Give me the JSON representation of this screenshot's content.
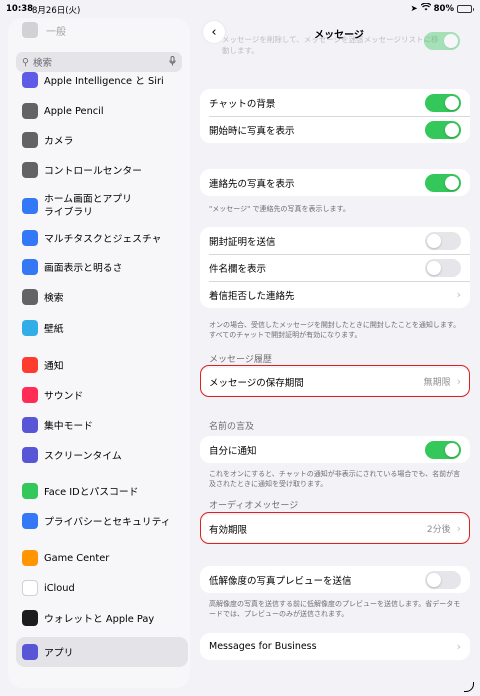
{
  "status": {
    "time": "10:38",
    "date": "8月26日(火)",
    "battery": "80%",
    "battery_level": 0.8
  },
  "sidebar": {
    "faded_top": "一般",
    "search_placeholder": "検索",
    "items": [
      {
        "label": "Apple Intelligence と Siri",
        "icon": "siri-icon",
        "color": "#5e5ce6"
      },
      {
        "label": "Apple Pencil",
        "icon": "pencil-icon",
        "color": "#636366"
      },
      {
        "label": "カメラ",
        "icon": "camera-icon",
        "color": "#636366"
      },
      {
        "label": "コントロールセンター",
        "icon": "control-center-icon",
        "color": "#636366"
      },
      {
        "label": "ホーム画面とアプリ\nライブラリ",
        "icon": "home-screen-icon",
        "color": "#3478f6"
      },
      {
        "label": "マルチタスクとジェスチャ",
        "icon": "multitask-icon",
        "color": "#3478f6"
      },
      {
        "label": "画面表示と明るさ",
        "icon": "brightness-icon",
        "color": "#3478f6"
      },
      {
        "label": "検索",
        "icon": "search-icon",
        "color": "#636366"
      },
      {
        "label": "壁紙",
        "icon": "wallpaper-icon",
        "color": "#32ade6"
      },
      {
        "label": "通知",
        "icon": "notification-icon",
        "color": "#ff3b30"
      },
      {
        "label": "サウンド",
        "icon": "sound-icon",
        "color": "#ff2d55"
      },
      {
        "label": "集中モード",
        "icon": "focus-icon",
        "color": "#5856d6"
      },
      {
        "label": "スクリーンタイム",
        "icon": "hourglass-icon",
        "color": "#5856d6"
      },
      {
        "label": "Face IDとパスコード",
        "icon": "face-id-icon",
        "color": "#34c759"
      },
      {
        "label": "プライバシーとセキュリティ",
        "icon": "hand-icon",
        "color": "#3478f6"
      },
      {
        "label": "Game Center",
        "icon": "game-center-icon",
        "color": "#ff9500"
      },
      {
        "label": "iCloud",
        "icon": "icloud-icon",
        "color": "#ffffff"
      },
      {
        "label": "ウォレットと Apple Pay",
        "icon": "wallet-icon",
        "color": "#1c1c1e"
      },
      {
        "label": "アプリ",
        "icon": "apps-icon",
        "color": "#5856d6",
        "selected": true
      }
    ]
  },
  "detail": {
    "title": "メッセージ",
    "faded_text": "メッセージを削除して、メッセージを迷惑メッセージリストに移動します。",
    "group1": [
      {
        "label": "チャットの背景",
        "toggle": true
      },
      {
        "label": "開始時に写真を表示",
        "toggle": true
      }
    ],
    "group2": [
      {
        "label": "連絡先の写真を表示",
        "toggle": true
      }
    ],
    "group2_footer": "\"メッセージ\" で連絡先の写真を表示します。",
    "group3": [
      {
        "label": "開封証明を送信",
        "toggle": false
      },
      {
        "label": "件名欄を表示",
        "toggle": false
      },
      {
        "label": "着信拒否した連絡先",
        "chevron": true
      }
    ],
    "group3_footer": "オンの場合、受信したメッセージを開封したときに開封したことを通知します。すべてのチャットで開封証明が有効になります。",
    "history_header": "メッセージ履歴",
    "keep_messages": {
      "label": "メッセージの保存期間",
      "value": "無期限"
    },
    "name_header": "名前の言及",
    "notify_me": {
      "label": "自分に通知",
      "toggle": true
    },
    "name_footer": "これをオンにすると、チャットの通知が非表示にされている場合でも、名前が言及されたときに通知を受け取ります。",
    "audio_header": "オーディオメッセージ",
    "expire": {
      "label": "有効期限",
      "value": "2分後"
    },
    "low_quality": {
      "label": "低解像度の写真プレビューを送信",
      "toggle": false
    },
    "low_quality_footer": "高解像度の写真を送信する前に低解像度のプレビューを送信します。省データモードでは、プレビューのみが送信されます。",
    "business": {
      "label": "Messages for Business"
    }
  }
}
